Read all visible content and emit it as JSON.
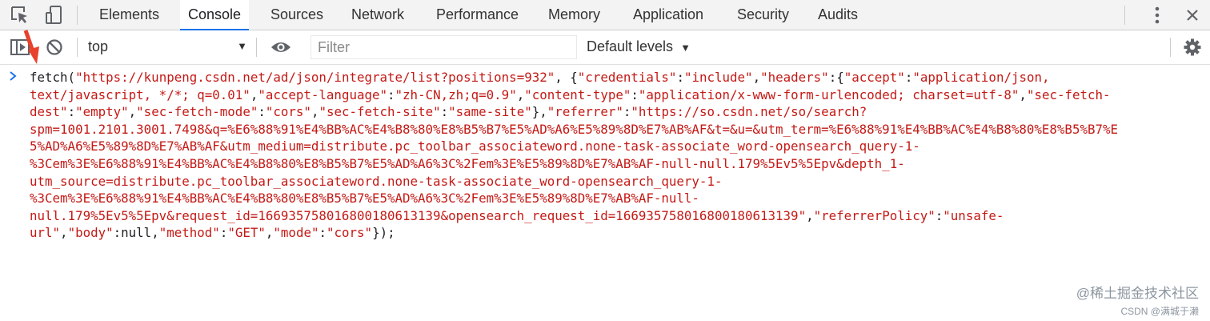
{
  "tabs": [
    {
      "label": "Elements"
    },
    {
      "label": "Console"
    },
    {
      "label": "Sources"
    },
    {
      "label": "Network"
    },
    {
      "label": "Performance"
    },
    {
      "label": "Memory"
    },
    {
      "label": "Application"
    },
    {
      "label": "Security"
    },
    {
      "label": "Audits"
    }
  ],
  "active_tab": "Console",
  "toolbar": {
    "context": "top",
    "filter_placeholder": "Filter",
    "levels": "Default levels"
  },
  "console": {
    "lines": [
      [
        [
          "fetch(",
          "plain"
        ],
        [
          "\"https://kunpeng.csdn.net/ad/json/integrate/list?positions=932\"",
          "str"
        ],
        [
          ", {",
          "plain"
        ],
        [
          "\"credentials\"",
          "str"
        ],
        [
          ":",
          "plain"
        ],
        [
          "\"include\"",
          "str"
        ],
        [
          ",",
          "plain"
        ],
        [
          "\"headers\"",
          "str"
        ],
        [
          ":{",
          "plain"
        ],
        [
          "\"accept\"",
          "str"
        ],
        [
          ":",
          "plain"
        ],
        [
          "\"application/json,",
          "str"
        ]
      ],
      [
        [
          "text/javascript, */*; q=0.01\"",
          "str"
        ],
        [
          ",",
          "plain"
        ],
        [
          "\"accept-language\"",
          "str"
        ],
        [
          ":",
          "plain"
        ],
        [
          "\"zh-CN,zh;q=0.9\"",
          "str"
        ],
        [
          ",",
          "plain"
        ],
        [
          "\"content-type\"",
          "str"
        ],
        [
          ":",
          "plain"
        ],
        [
          "\"application/x-www-form-urlencoded; charset=utf-8\"",
          "str"
        ],
        [
          ",",
          "plain"
        ],
        [
          "\"sec-fetch-",
          "str"
        ]
      ],
      [
        [
          "dest\"",
          "str"
        ],
        [
          ":",
          "plain"
        ],
        [
          "\"empty\"",
          "str"
        ],
        [
          ",",
          "plain"
        ],
        [
          "\"sec-fetch-mode\"",
          "str"
        ],
        [
          ":",
          "plain"
        ],
        [
          "\"cors\"",
          "str"
        ],
        [
          ",",
          "plain"
        ],
        [
          "\"sec-fetch-site\"",
          "str"
        ],
        [
          ":",
          "plain"
        ],
        [
          "\"same-site\"",
          "str"
        ],
        [
          "},",
          "plain"
        ],
        [
          "\"referrer\"",
          "str"
        ],
        [
          ":",
          "plain"
        ],
        [
          "\"https://so.csdn.net/so/search?",
          "str"
        ]
      ],
      [
        [
          "spm=1001.2101.3001.7498&q=%E6%88%91%E4%BB%AC%E4%B8%80%E8%B5%B7%E5%AD%A6%E5%89%8D%E7%AB%AF&t=&u=&utm_term=%E6%88%91%E4%BB%AC%E4%B8%80%E8%B5%B7%E",
          "str"
        ]
      ],
      [
        [
          "5%AD%A6%E5%89%8D%E7%AB%AF&utm_medium=distribute.pc_toolbar_associateword.none-task-associate_word-opensearch_query-1-",
          "str"
        ]
      ],
      [
        [
          "%3Cem%3E%E6%88%91%E4%BB%AC%E4%B8%80%E8%B5%B7%E5%AD%A6%3C%2Fem%3E%E5%89%8D%E7%AB%AF-null-null.179%5Ev5%5Epv&depth_1-",
          "str"
        ]
      ],
      [
        [
          "utm_source=distribute.pc_toolbar_associateword.none-task-associate_word-opensearch_query-1-",
          "str"
        ]
      ],
      [
        [
          "%3Cem%3E%E6%88%91%E4%BB%AC%E4%B8%80%E8%B5%B7%E5%AD%A6%3C%2Fem%3E%E5%89%8D%E7%AB%AF-null-",
          "str"
        ]
      ],
      [
        [
          "null.179%5Ev5%5Epv&request_id=166935758016800180613139&opensearch_request_id=166935758016800180613139\"",
          "str"
        ],
        [
          ",",
          "plain"
        ],
        [
          "\"referrerPolicy\"",
          "str"
        ],
        [
          ":",
          "plain"
        ],
        [
          "\"unsafe-",
          "str"
        ]
      ],
      [
        [
          "url\"",
          "str"
        ],
        [
          ",",
          "plain"
        ],
        [
          "\"body\"",
          "str"
        ],
        [
          ":null,",
          "plain"
        ],
        [
          "\"method\"",
          "str"
        ],
        [
          ":",
          "plain"
        ],
        [
          "\"GET\"",
          "str"
        ],
        [
          ",",
          "plain"
        ],
        [
          "\"mode\"",
          "str"
        ],
        [
          ":",
          "plain"
        ],
        [
          "\"cors\"",
          "str"
        ],
        [
          "});",
          "plain"
        ]
      ]
    ]
  },
  "watermark": {
    "line1": "@稀土掘金技术社区",
    "line2": "CSDN @满城于濑"
  },
  "colors": {
    "string": "#c41a16",
    "active_tab_underline": "#1a73e8",
    "annotation_arrow": "#e8412c"
  }
}
